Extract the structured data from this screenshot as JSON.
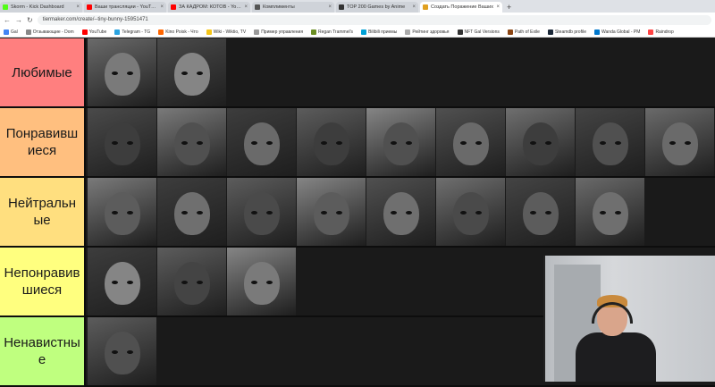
{
  "browser": {
    "tabs": [
      {
        "label": "Skorm - Kick Dashboard",
        "favicon_color": "#53fc18",
        "active": false
      },
      {
        "label": "Ваши трансляции - YouTube",
        "favicon_color": "#ff0000",
        "active": false
      },
      {
        "label": "ЗА КАДРОМ: КОТОВ - YouTube",
        "favicon_color": "#ff0000",
        "active": false
      },
      {
        "label": "Комплименты",
        "favicon_color": "#555555",
        "active": false
      },
      {
        "label": "TOP 200 Games by Anime",
        "favicon_color": "#333333",
        "active": false
      },
      {
        "label": "Создать Поражение Ваших",
        "favicon_color": "#e0a020",
        "active": true
      }
    ],
    "new_tab_label": "+",
    "address": "tiermaker.com/create/--tiny-bunny-15951471",
    "bookmarks": [
      {
        "label": "Gal",
        "color": "#4285f4"
      },
      {
        "label": "Отзывающие - Dom",
        "color": "#888888"
      },
      {
        "label": "YouTube",
        "color": "#ff0000"
      },
      {
        "label": "Telegram - TG",
        "color": "#2aa3e0"
      },
      {
        "label": "Kino Poisk - Что",
        "color": "#ff6600"
      },
      {
        "label": "Wiki - Wiktio, TV",
        "color": "#f5c518"
      },
      {
        "label": "Пример управления",
        "color": "#999999"
      },
      {
        "label": "Regan Trammel's",
        "color": "#6b8e23"
      },
      {
        "label": "Bilibili приемы",
        "color": "#00a1d6"
      },
      {
        "label": "Рейтинг здоровья",
        "color": "#aaaaaa"
      },
      {
        "label": "NFT Gal Versions",
        "color": "#333333"
      },
      {
        "label": "Path of Exile",
        "color": "#8b4513"
      },
      {
        "label": "Steamdb profile",
        "color": "#1b2838"
      },
      {
        "label": "Wanda Global - PM",
        "color": "#0077cc"
      },
      {
        "label": "Raindrop",
        "color": "#ff4444"
      }
    ]
  },
  "tiers": [
    {
      "label": "Любимые",
      "color": "#ff7f7f",
      "item_count": 2
    },
    {
      "label": "Понравившиеся",
      "color": "#ffbf7f",
      "item_count": 9
    },
    {
      "label": "Нейтральные",
      "color": "#ffdf7f",
      "item_count": 8
    },
    {
      "label": "Непонравившиеся",
      "color": "#ffff7f",
      "item_count": 3
    },
    {
      "label": "Ненавистные",
      "color": "#bfff7f",
      "item_count": 1
    }
  ]
}
